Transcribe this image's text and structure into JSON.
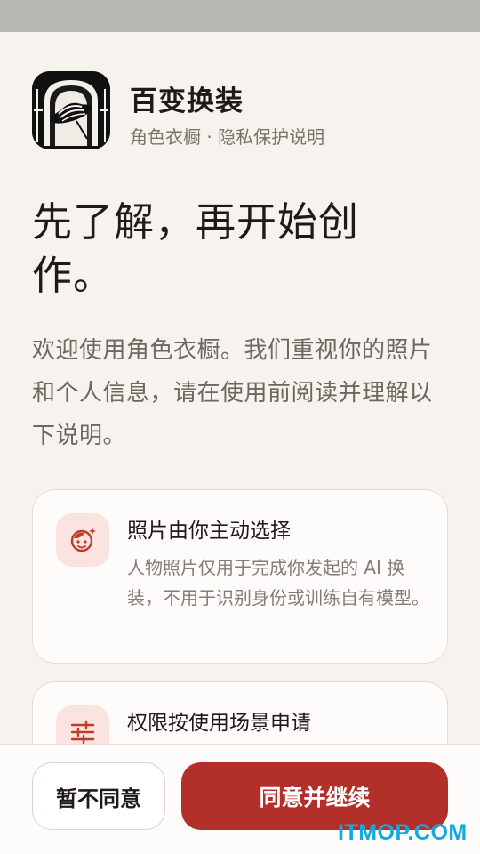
{
  "app": {
    "name": "百变换装",
    "subtitle": "角色衣橱 · 隐私保护说明"
  },
  "headline": "先了解，再开始创作。",
  "intro": "欢迎使用角色衣橱。我们重视你的照片和个人信息，请在使用前阅读并理解以下说明。",
  "cards": [
    {
      "icon": "face-icon",
      "title": "照片由你主动选择",
      "body": "人物照片仅用于完成你发起的 AI 换装，不用于识别身份或训练自有模型。"
    },
    {
      "icon": "sliders-icon",
      "title": "权限按使用场景申请",
      "body": ""
    }
  ],
  "buttons": {
    "decline": "暂不同意",
    "accept": "同意并继续"
  },
  "watermark": "ITMOP.COM",
  "colors": {
    "background": "#f6f3ee",
    "accent": "#b3302a",
    "icon_bg": "#fbe4df",
    "watermark": "#12a9e0"
  }
}
